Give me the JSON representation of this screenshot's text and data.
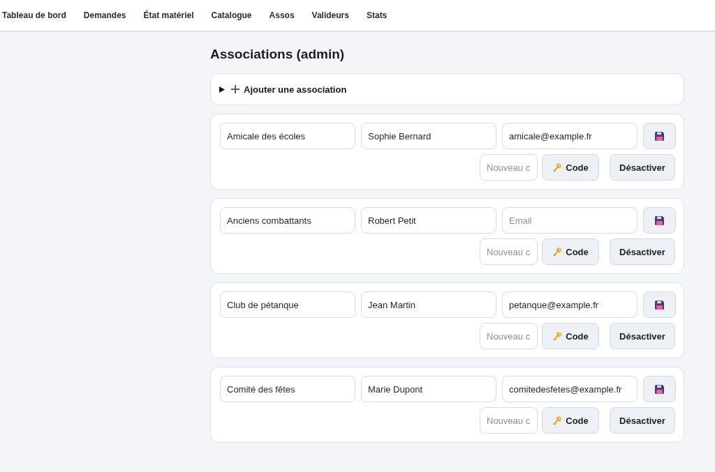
{
  "nav": [
    {
      "label": "Tableau de bord"
    },
    {
      "label": "Demandes"
    },
    {
      "label": "État matériel"
    },
    {
      "label": "Catalogue"
    },
    {
      "label": "Assos"
    },
    {
      "label": "Valideurs"
    },
    {
      "label": "Stats"
    }
  ],
  "page_title": "Associations (admin)",
  "add_section": {
    "label": "Ajouter une association",
    "expanded": false
  },
  "associations": [
    {
      "name": "Amicale des écoles",
      "contact": "Sophie Bernard",
      "email": {
        "value": "amicale@example.fr"
      },
      "code_placeholder": "Nouveau c",
      "code_button": "Code",
      "deactivate_button": "Désactiver"
    },
    {
      "name": "Anciens combattants",
      "contact": "Robert Petit",
      "email": {
        "placeholder": "Email"
      },
      "code_placeholder": "Nouveau c",
      "code_button": "Code",
      "deactivate_button": "Désactiver"
    },
    {
      "name": "Club de pétanque",
      "contact": "Jean Martin",
      "email": {
        "value": "petanque@example.fr"
      },
      "code_placeholder": "Nouveau c",
      "code_button": "Code",
      "deactivate_button": "Désactiver"
    },
    {
      "name": "Comité des fêtes",
      "contact": "Marie Dupont",
      "email": {
        "value": "comitedesfetes@example.fr"
      },
      "code_placeholder": "Nouveau c",
      "code_button": "Code",
      "deactivate_button": "Désactiver"
    }
  ]
}
